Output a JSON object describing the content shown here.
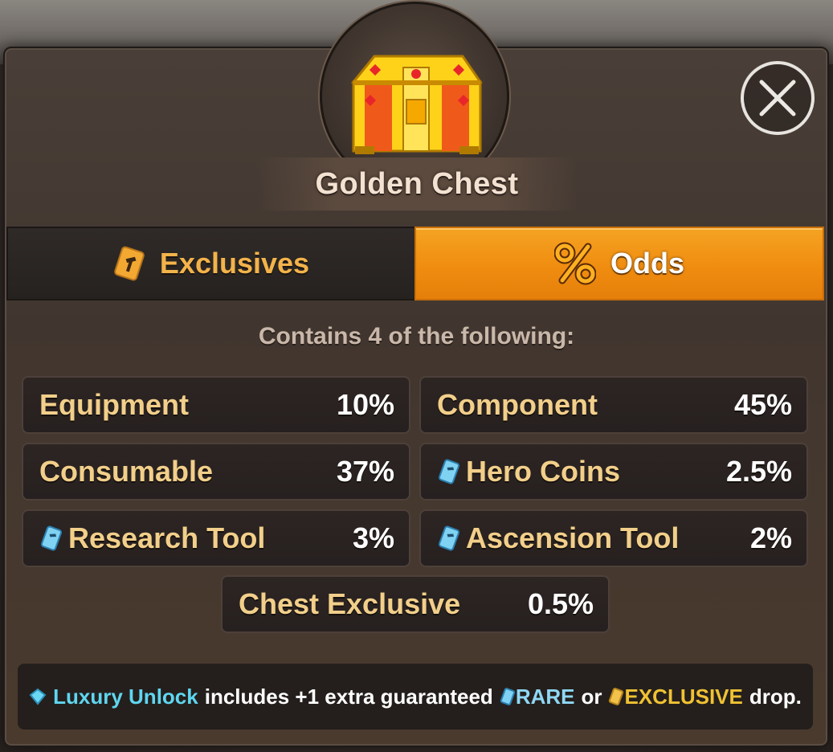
{
  "chest": {
    "title": "Golden Chest"
  },
  "tabs": [
    {
      "label": "Exclusives",
      "icon": "tool-card-icon",
      "active": false
    },
    {
      "label": "Odds",
      "icon": "percent-icon",
      "active": true
    }
  ],
  "contains_text": "Contains 4 of the following:",
  "odds": [
    {
      "label": "Equipment",
      "value": "10%",
      "icon": ""
    },
    {
      "label": "Component",
      "value": "45%",
      "icon": ""
    },
    {
      "label": "Consumable",
      "value": "37%",
      "icon": ""
    },
    {
      "label": "Hero Coins",
      "value": "2.5%",
      "icon": "rare-gem-icon"
    },
    {
      "label": "Research Tool",
      "value": "3%",
      "icon": "rare-gem-icon"
    },
    {
      "label": "Ascension Tool",
      "value": "2%",
      "icon": "rare-gem-icon"
    },
    {
      "label": "Chest Exclusive",
      "value": "0.5%",
      "icon": ""
    }
  ],
  "footer": {
    "luxury": "Luxury Unlock",
    "middle": "includes +1 extra guaranteed",
    "rare": "RARE",
    "or": "or",
    "exclusive": "EXCLUSIVE",
    "end": "drop."
  },
  "colors": {
    "accent_orange": "#f08d10",
    "label_gold": "#f2cf8a",
    "luxury_cyan": "#5fd6f0",
    "exclusive_yellow": "#f0c233"
  }
}
